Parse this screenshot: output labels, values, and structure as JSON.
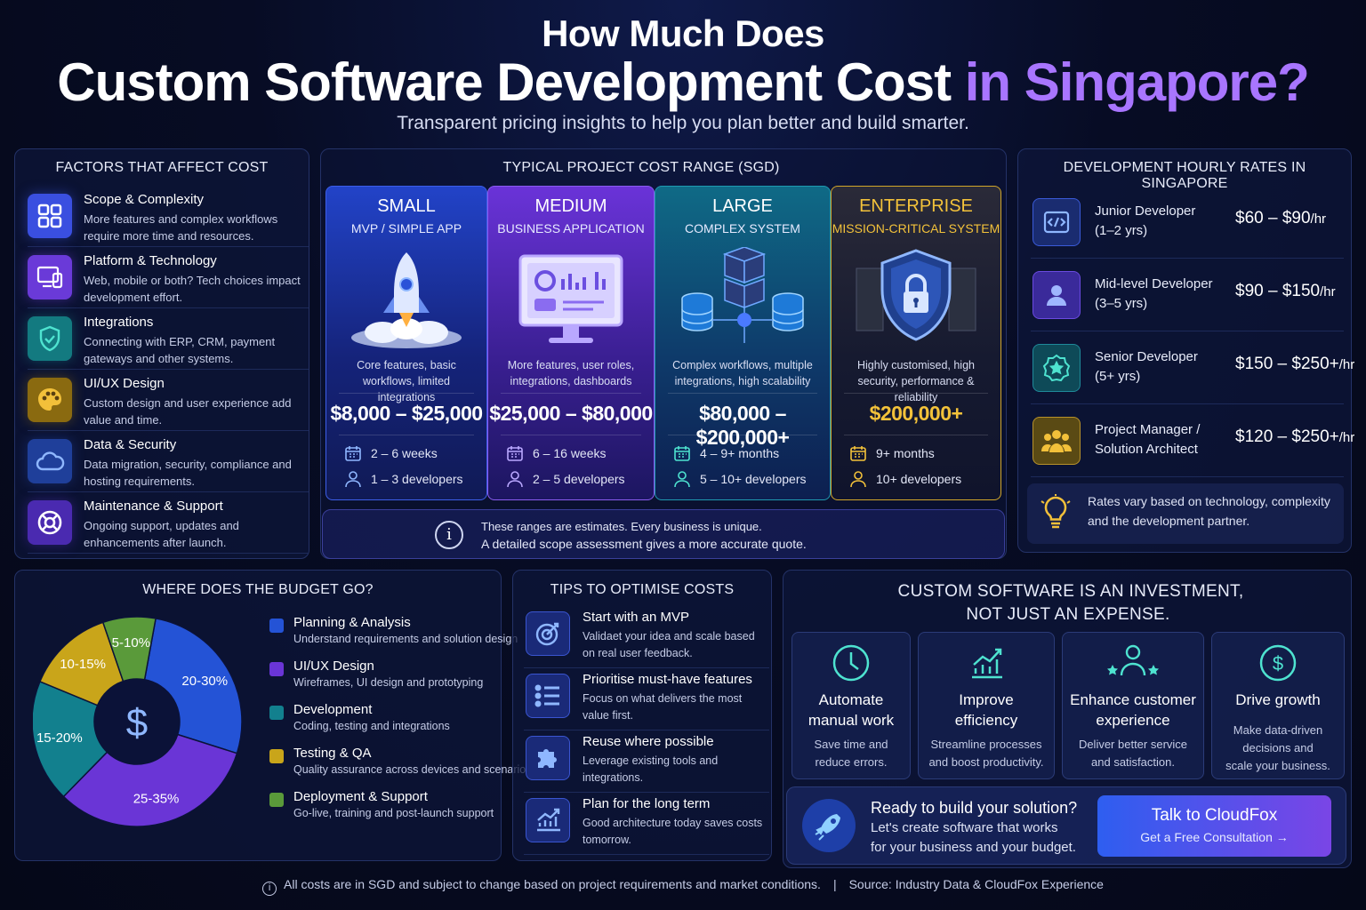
{
  "header": {
    "line1": "How Much Does",
    "line2_main": "Custom Software Development Cost ",
    "line2_highlight": "in Singapore?",
    "subtitle": "Transparent pricing insights to help you plan better and build smarter."
  },
  "factors": {
    "title": "FACTORS THAT AFFECT COST",
    "items": [
      {
        "icon": "grid-icon",
        "title": "Scope & Complexity",
        "desc": "More features and complex workflows require more time and resources.",
        "color": "#3a4fe0"
      },
      {
        "icon": "devices-icon",
        "title": "Platform & Technology",
        "desc": "Web, mobile or both? Tech choices impact development effort.",
        "color": "#6a3ad8"
      },
      {
        "icon": "shield-check-icon",
        "title": "Integrations",
        "desc": "Connecting with ERP, CRM, payment gateways and other systems.",
        "color": "#137a80"
      },
      {
        "icon": "palette-icon",
        "title": "UI/UX Design",
        "desc": "Custom design and user experience add value and time.",
        "color": "#8a6a10"
      },
      {
        "icon": "cloud-icon",
        "title": "Data & Security",
        "desc": "Data migration, security, compliance and hosting requirements.",
        "color": "#1f3f9a"
      },
      {
        "icon": "lifebuoy-icon",
        "title": "Maintenance & Support",
        "desc": "Ongoing support, updates and enhancements after launch.",
        "color": "#4a2ab0"
      }
    ]
  },
  "costs": {
    "title": "TYPICAL PROJECT COST RANGE (SGD)",
    "tiers": [
      {
        "name": "SMALL",
        "sub": "MVP / SIMPLE APP",
        "desc": "Core features, basic workflows, limited integrations",
        "price": "$8,000 – $25,000",
        "time": "2 – 6 weeks",
        "team": "1 – 3 developers",
        "illustration": "rocket-icon"
      },
      {
        "name": "MEDIUM",
        "sub": "BUSINESS APPLICATION",
        "desc": "More features, user roles, integrations, dashboards",
        "price": "$25,000 – $80,000",
        "time": "6 – 16 weeks",
        "team": "2 – 5 developers",
        "illustration": "dashboard-monitor-icon"
      },
      {
        "name": "LARGE",
        "sub": "COMPLEX SYSTEM",
        "desc": "Complex workflows, multiple integrations, high scalability",
        "price": "$80,000 – $200,000+",
        "time": "4 – 9+ months",
        "team": "5 – 10+ developers",
        "illustration": "server-database-icon"
      },
      {
        "name": "ENTERPRISE",
        "sub": "MISSION-CRITICAL SYSTEM",
        "desc": "Highly customised, high security, performance & reliability",
        "price": "$200,000+",
        "time": "9+ months",
        "team": "10+ developers",
        "illustration": "security-lock-icon"
      }
    ],
    "note1": "These ranges are estimates. Every business is unique.",
    "note2": "A detailed scope assessment gives a more accurate quote."
  },
  "rates": {
    "title": "DEVELOPMENT HOURLY RATES IN SINGAPORE",
    "items": [
      {
        "icon": "code-icon",
        "role1": "Junior Developer",
        "role2": "(1–2 yrs)",
        "range": "$60 – $90",
        "unit": "/hr"
      },
      {
        "icon": "user-icon",
        "role1": "Mid-level Developer",
        "role2": "(3–5 yrs)",
        "range": "$90 – $150",
        "unit": "/hr"
      },
      {
        "icon": "badge-star-icon",
        "role1": "Senior Developer",
        "role2": "(5+ yrs)",
        "range": "$150 – $250+",
        "unit": "/hr"
      },
      {
        "icon": "team-icon",
        "role1": "Project Manager /",
        "role2": "Solution Architect",
        "range": "$120 – $250+",
        "unit": "/hr"
      }
    ],
    "note1": "Rates vary based on technology, complexity",
    "note2": "and the development partner."
  },
  "budget": {
    "title": "WHERE DOES THE BUDGET GO?",
    "center_symbol": "$",
    "slices": [
      {
        "label": "20-30%",
        "value": 25,
        "color": "#2453d6"
      },
      {
        "label": "25-35%",
        "value": 30,
        "color": "#6a35d6"
      },
      {
        "label": "15-20%",
        "value": 17.5,
        "color": "#12808e"
      },
      {
        "label": "10-15%",
        "value": 12.5,
        "color": "#c9a51a"
      },
      {
        "label": "5-10%",
        "value": 7.5,
        "color": "#5a9a3a"
      }
    ],
    "legend": [
      {
        "title": "Planning & Analysis",
        "desc": "Understand requirements and solution design",
        "color": "#2453d6"
      },
      {
        "title": "UI/UX Design",
        "desc": "Wireframes, UI design and prototyping",
        "color": "#6a35d6"
      },
      {
        "title": "Development",
        "desc": "Coding, testing and integrations",
        "color": "#12808e"
      },
      {
        "title": "Testing & QA",
        "desc": "Quality assurance across devices and scenarios",
        "color": "#c9a51a"
      },
      {
        "title": "Deployment & Support",
        "desc": "Go-live, training and post-launch support",
        "color": "#5a9a3a"
      }
    ]
  },
  "tips": {
    "title": "TIPS TO OPTIMISE COSTS",
    "items": [
      {
        "icon": "target-icon",
        "title": "Start with an MVP",
        "desc": "Validaet your idea and scale based on real user feedback."
      },
      {
        "icon": "list-icon",
        "title": "Prioritise must-have features",
        "desc": "Focus on what delivers the most value first."
      },
      {
        "icon": "puzzle-icon",
        "title": "Reuse where possible",
        "desc": "Leverage existing tools and integrations."
      },
      {
        "icon": "chart-up-icon",
        "title": "Plan for the long term",
        "desc": "Good architecture today saves costs tomorrow."
      }
    ]
  },
  "invest": {
    "title1": "CUSTOM SOFTWARE IS AN INVESTMENT,",
    "title2": "NOT JUST AN EXPENSE.",
    "cards": [
      {
        "icon": "clock-icon",
        "t1": "Automate",
        "t2": "manual work",
        "d1": "Save time and",
        "d2": "reduce errors."
      },
      {
        "icon": "growth-chart-icon",
        "t1": "Improve",
        "t2": "efficiency",
        "d1": "Streamline processes",
        "d2": "and boost productivity."
      },
      {
        "icon": "customer-stars-icon",
        "t1": "Enhance customer",
        "t2": "experience",
        "d1": "Deliver better service",
        "d2": "and satisfaction."
      },
      {
        "icon": "dollar-circle-icon",
        "t1": "Drive growth",
        "t2": "",
        "d1": "Make data-driven",
        "d2": "decisions and",
        "d3": "scale your business."
      }
    ],
    "cta_title": "Ready to build your solution?",
    "cta_desc1": "Let's create software that works",
    "cta_desc2": "for your business and your budget.",
    "button_title": "Talk to CloudFox",
    "button_sub": "Get a Free Consultation →"
  },
  "footer": {
    "note": "All costs are in SGD and subject to change based on project requirements and market conditions.",
    "divider": "|",
    "source": "Source: Industry Data & CloudFox Experience"
  },
  "colors": {
    "accent": "#a875ff",
    "small": "#1f3fb8",
    "medium": "#5a2fc8",
    "large": "#0f5a7a",
    "enterprise": "#f3c23a"
  }
}
